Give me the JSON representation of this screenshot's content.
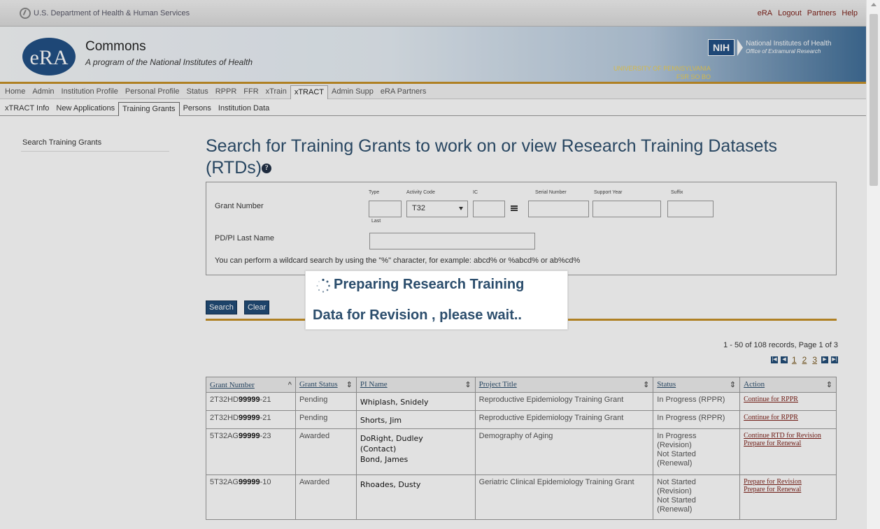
{
  "top": {
    "agency": "U.S. Department of Health & Human Services",
    "links": [
      "eRA",
      "Logout",
      "Partners",
      "Help"
    ]
  },
  "banner": {
    "logo": "eRA",
    "app": "Commons",
    "tagline": "A program of the National Institutes of Health",
    "institution": "UNIVERSITY OF PENNSYLVANIA",
    "roles": "FSR SO BO",
    "nih_badge": "NIH",
    "nih_name": "National Institutes of Health",
    "nih_office": "Office of Extramural Research"
  },
  "nav": {
    "main": [
      "Home",
      "Admin",
      "Institution Profile",
      "Personal Profile",
      "Status",
      "RPPR",
      "FFR",
      "xTrain",
      "xTRACT",
      "Admin Supp",
      "eRA Partners"
    ],
    "active_main": "xTRACT",
    "sub": [
      "xTRACT Info",
      "New Applications",
      "Training Grants",
      "Persons",
      "Institution Data"
    ],
    "active_sub": "Training Grants"
  },
  "sidebar": {
    "item": "Search Training Grants"
  },
  "page": {
    "title": "Search for Training Grants to work on or view Research Training Datasets (RTDs)"
  },
  "search": {
    "grant_number_label": "Grant Number",
    "type_label": "Type",
    "activity_code_label": "Activity Code",
    "activity_code_value": "T32",
    "ic_label": "IC",
    "serial_label": "Serial Number",
    "support_year_label": "Support Year",
    "suffix_label": "Suffix",
    "pdpi_label": "PD/PI Last Name",
    "last_label": "Last",
    "hint": "You can perform a wildcard search by using the \"%\" character, for example: abcd% or %abcd% or ab%cd%",
    "search_btn": "Search",
    "clear_btn": "Clear"
  },
  "loading": {
    "line1": "Preparing Research Training",
    "line2": "Data for Revision , please wait.."
  },
  "results": {
    "summary": "1 - 50 of 108 records, Page 1 of 3",
    "pages": [
      "1",
      "2",
      "3"
    ],
    "columns": [
      "Grant Number",
      "Grant Status",
      "PI Name",
      "Project Title",
      "Status",
      "Action"
    ],
    "rows": [
      {
        "grant_prefix": "2T32HD",
        "grant_serial": "99999",
        "grant_suffix": "-21",
        "grant_status": "Pending",
        "pi": [
          "Whiplash, Snidely"
        ],
        "title": "Reproductive Epidemiology Training Grant",
        "status": [
          "In Progress (RPPR)"
        ],
        "actions": [
          "Continue for RPPR"
        ]
      },
      {
        "grant_prefix": "2T32HD",
        "grant_serial": "99999",
        "grant_suffix": "-21",
        "grant_status": "Pending",
        "pi": [
          "Shorts, Jim"
        ],
        "title": "Reproductive Epidemiology Training Grant",
        "status": [
          "In Progress (RPPR)"
        ],
        "actions": [
          "Continue for RPPR"
        ]
      },
      {
        "grant_prefix": "5T32AG",
        "grant_serial": "99999",
        "grant_suffix": "-23",
        "grant_status": "Awarded",
        "pi": [
          "DoRight, Dudley",
          "(Contact)",
          "Bond, James"
        ],
        "title": "Demography of Aging",
        "status": [
          "In Progress",
          "(Revision)",
          "Not Started",
          "(Renewal)"
        ],
        "actions": [
          "Continue RTD for Revision",
          "Prepare for Renewal"
        ]
      },
      {
        "grant_prefix": "5T32AG",
        "grant_serial": "99999",
        "grant_suffix": "-10",
        "grant_status": "Awarded",
        "pi": [
          "Rhoades, Dusty"
        ],
        "title": "Geriatric Clinical Epidemiology Training Grant",
        "status": [
          "Not Started",
          "(Revision)",
          "Not Started",
          "(Renewal)"
        ],
        "actions": [
          "Prepare for Revision",
          "Prepare for Renewal"
        ]
      }
    ]
  }
}
